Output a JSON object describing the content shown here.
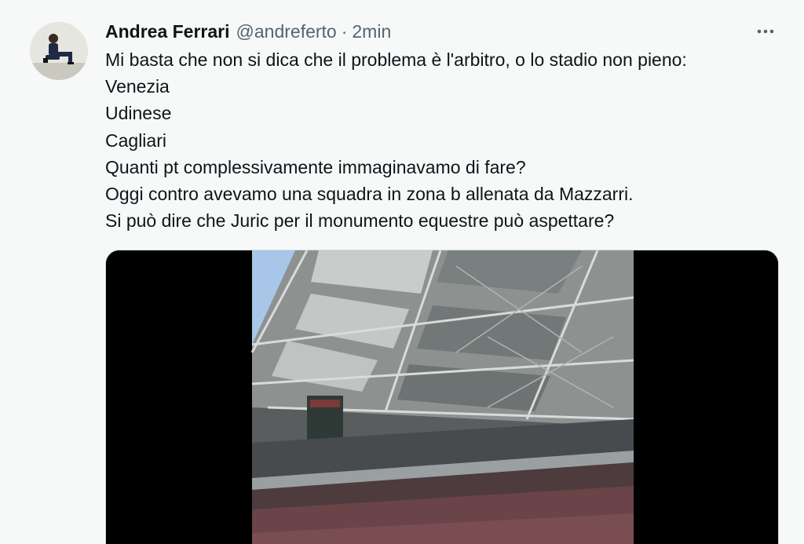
{
  "tweet": {
    "author_name": "Andrea Ferrari",
    "handle": "@andreferto",
    "separator": "·",
    "timestamp": "2min",
    "more_icon": "more-horizontal-icon",
    "lines": [
      "Mi basta che non si dica che il problema è l'arbitro, o lo stadio non pieno:",
      "Venezia",
      "Udinese",
      "Cagliari",
      "Quanti pt complessivamente immaginavamo di fare?",
      "Oggi contro avevamo una squadra in zona b allenata da Mazzarri.",
      "Si può dire che Juric per il monumento equestre può aspettare?"
    ],
    "media_type": "video"
  },
  "colors": {
    "background": "#f7f9f9",
    "text": "#0f1419",
    "secondary_text": "#536471",
    "media_border": "#cfd9de"
  }
}
